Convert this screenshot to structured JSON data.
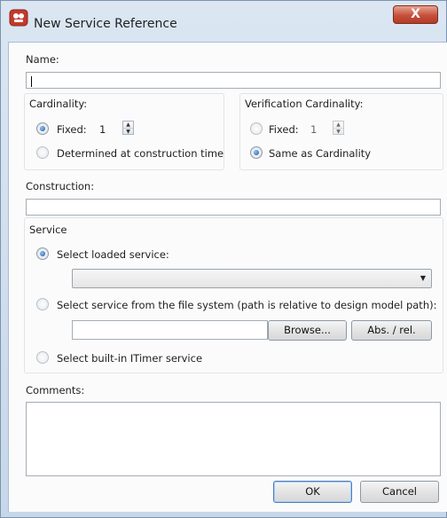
{
  "window": {
    "title": "New Service Reference",
    "close_glyph": "X"
  },
  "name": {
    "label": "Name:",
    "value": ""
  },
  "cardinality": {
    "label": "Cardinality:",
    "fixed_label": "Fixed:",
    "fixed_value": "1",
    "determined_label": "Determined at construction time",
    "selected": "fixed"
  },
  "verification_cardinality": {
    "label": "Verification Cardinality:",
    "fixed_label": "Fixed:",
    "fixed_value": "1",
    "same_label": "Same as Cardinality",
    "selected": "same"
  },
  "construction": {
    "label": "Construction:",
    "value": ""
  },
  "service": {
    "group_label": "Service",
    "loaded_label": "Select loaded service:",
    "loaded_value": "",
    "file_label": "Select service from the file system (path is relative to design model path):",
    "file_value": "",
    "browse_label": "Browse...",
    "abs_rel_label": "Abs. / rel.",
    "builtin_label": "Select built-in ITimer service",
    "selected": "loaded"
  },
  "comments": {
    "label": "Comments:",
    "value": ""
  },
  "buttons": {
    "ok": "OK",
    "cancel": "Cancel"
  },
  "icons": {
    "app": "red-app-icon",
    "spin_up": "▲",
    "spin_down": "▼",
    "dropdown": "▼"
  },
  "colors": {
    "close_button": "#c4503a",
    "radio_selected": "#1a56a6",
    "window_frame": "#c6d7ea"
  }
}
